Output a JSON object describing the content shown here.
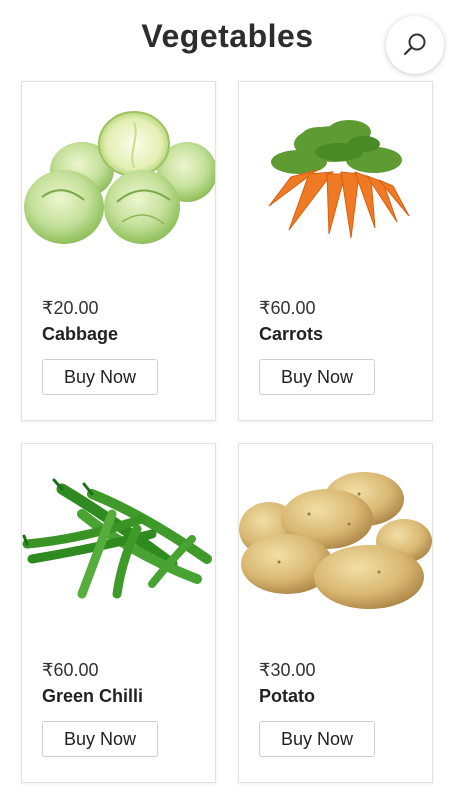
{
  "header": {
    "title": "Vegetables",
    "search_icon": "search-icon"
  },
  "products": [
    {
      "price": "₹20.00",
      "name": "Cabbage",
      "button_label": "Buy Now",
      "image": "cabbage-image"
    },
    {
      "price": "₹60.00",
      "name": "Carrots",
      "button_label": "Buy Now",
      "image": "carrots-image"
    },
    {
      "price": "₹60.00",
      "name": "Green Chilli",
      "button_label": "Buy Now",
      "image": "green-chilli-image"
    },
    {
      "price": "₹30.00",
      "name": "Potato",
      "button_label": "Buy Now",
      "image": "potato-image"
    }
  ],
  "colors": {
    "cabbage": "#b6d98a",
    "carrot": "#f07a23",
    "carrot_leaf": "#5e9b32",
    "chilli": "#3f9a2a",
    "potato": "#d9b873"
  }
}
